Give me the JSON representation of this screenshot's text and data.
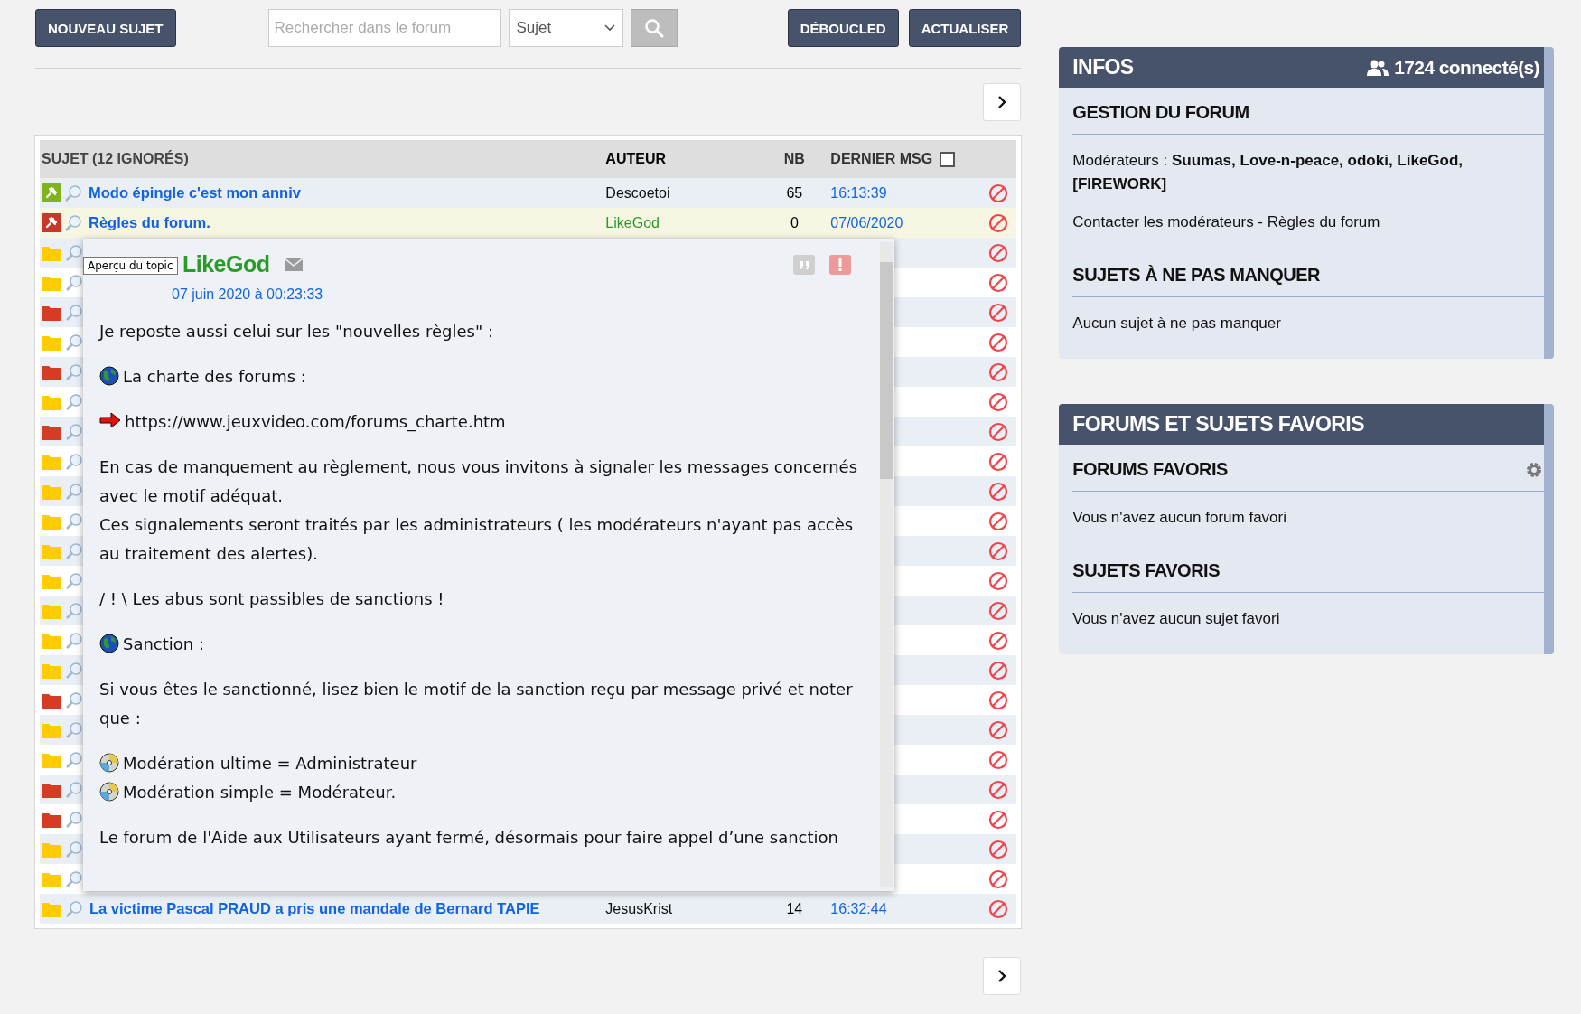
{
  "toolbar": {
    "new_topic": "NOUVEAU SUJET",
    "search": {
      "placeholder": "Rechercher dans le forum"
    },
    "search_scope": "Sujet",
    "buttons": [
      "DÉBOUCLED",
      "ACTUALISER"
    ]
  },
  "table": {
    "columns": [
      "SUJET (12 IGNORÉS)",
      "AUTEUR",
      "NB",
      "DERNIER MSG"
    ],
    "select_all_checked": false,
    "rows": [
      {
        "kind": "pinned",
        "color": "#7fb51a",
        "title": "Modo épingle c'est mon anniv",
        "author": "Descoetoi",
        "moderator": false,
        "count": "65",
        "last": "16:13:39"
      },
      {
        "kind": "pinned",
        "color": "#c8372a",
        "title": "Règles du forum.",
        "author": "LikeGod",
        "moderator": true,
        "count": "0",
        "last": "07/06/2020"
      },
      {
        "kind": "folder",
        "color": "#ffcc00"
      },
      {
        "kind": "folder",
        "color": "#ffcc00"
      },
      {
        "kind": "folder",
        "color": "#d63b24"
      },
      {
        "kind": "folder",
        "color": "#ffcc00"
      },
      {
        "kind": "folder",
        "color": "#d63b24"
      },
      {
        "kind": "folder",
        "color": "#ffcc00"
      },
      {
        "kind": "folder",
        "color": "#d63b24"
      },
      {
        "kind": "folder",
        "color": "#ffcc00"
      },
      {
        "kind": "folder",
        "color": "#ffcc00"
      },
      {
        "kind": "folder",
        "color": "#ffcc00"
      },
      {
        "kind": "folder",
        "color": "#ffcc00"
      },
      {
        "kind": "folder",
        "color": "#ffcc00"
      },
      {
        "kind": "folder",
        "color": "#ffcc00"
      },
      {
        "kind": "folder",
        "color": "#ffcc00"
      },
      {
        "kind": "folder",
        "color": "#ffcc00"
      },
      {
        "kind": "folder",
        "color": "#d63b24"
      },
      {
        "kind": "folder",
        "color": "#ffcc00"
      },
      {
        "kind": "folder",
        "color": "#ffcc00"
      },
      {
        "kind": "folder",
        "color": "#d63b24"
      },
      {
        "kind": "folder",
        "color": "#d63b24"
      },
      {
        "kind": "folder",
        "color": "#ffcc00"
      },
      {
        "kind": "folder",
        "color": "#ffcc00"
      },
      {
        "kind": "folder",
        "color": "#ffcc00",
        "title": "La victime Pascal PRAUD a pris une mandale de Bernard TAPIE",
        "author": "JesusKrist",
        "moderator": false,
        "count": "14",
        "last": "16:32:44"
      }
    ]
  },
  "preview": {
    "tooltip": "Aperçu du topic",
    "author": "LikeGod",
    "date": "07 juin 2020 à 00:23:33",
    "paragraphs": [
      [
        {
          "kind": "plain",
          "text": "Je reposte aussi celui sur les \"nouvelles règles\" :"
        }
      ],
      [
        {
          "kind": "globe",
          "text": "La charte des forums :"
        }
      ],
      [
        {
          "kind": "arrow",
          "text": "https://www.jeuxvideo.com/forums_charte.htm"
        }
      ],
      [
        {
          "kind": "plain",
          "text": "En cas de manquement au règlement, nous vous invitons à signaler les messages concernés avec le motif adéquat."
        },
        {
          "kind": "plain",
          "text": "Ces signalements seront traités par les administrateurs ( les modérateurs n'ayant pas accès au traitement des alertes)."
        }
      ],
      [
        {
          "kind": "plain",
          "text": "/ ! \\ Les abus sont passibles de sanctions !"
        }
      ],
      [
        {
          "kind": "globe",
          "text": "Sanction :"
        }
      ],
      [
        {
          "kind": "plain",
          "text": "Si vous êtes le sanctionné, lisez bien le motif de la sanction reçu par message privé et noter que :"
        }
      ],
      [
        {
          "kind": "disc",
          "text": "Modération ultime = Administrateur"
        },
        {
          "kind": "disc",
          "text": "Modération simple = Modérateur."
        }
      ],
      [
        {
          "kind": "plain",
          "text": "Le forum de l'Aide aux Utilisateurs ayant fermé, désormais pour faire appel d’une sanction"
        }
      ]
    ]
  },
  "sidebar": {
    "infos": {
      "title": "INFOS",
      "connected": "1724 connecté(s)",
      "management_title": "GESTION DU FORUM",
      "moderators": "Modérateurs : **Suumas, Love-n-peace, odoki, LikeGod, [FIREWORK]**",
      "contact": "Contacter les modérateurs - Règles du forum",
      "must_read_title": "SUJETS À NE PAS MANQUER",
      "must_read_empty": "Aucun sujet à ne pas manquer"
    },
    "favorites": {
      "title": "FORUMS ET SUJETS FAVORIS",
      "forums_title": "FORUMS FAVORIS",
      "forums_empty": "Vous n'avez aucun forum favori",
      "topics_title": "SUJETS FAVORIS",
      "topics_empty": "Vous n'avez aucun sujet favori"
    }
  }
}
